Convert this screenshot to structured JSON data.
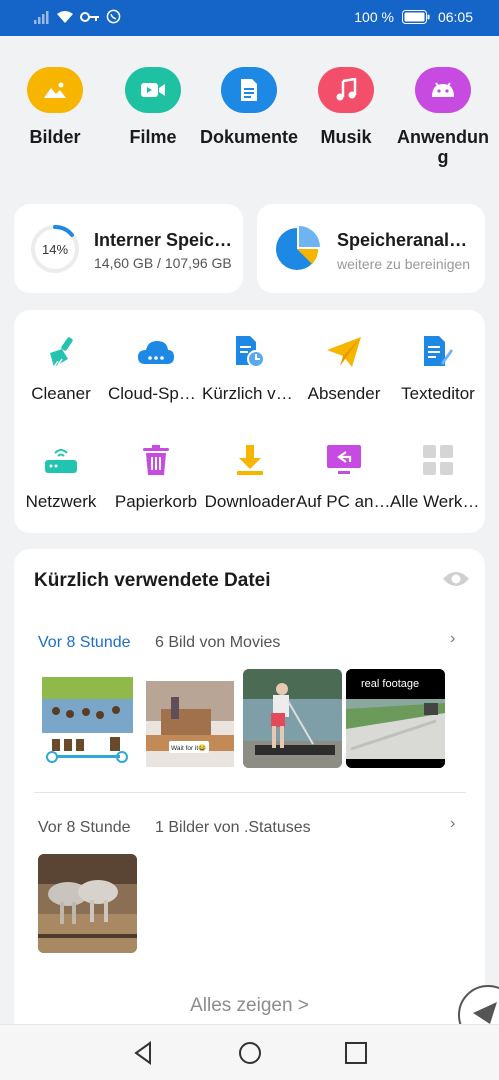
{
  "status_bar": {
    "battery": "100 %",
    "time": "06:05"
  },
  "categories": [
    {
      "label": "Bilder",
      "icon": "image-icon",
      "color": "#f7b500"
    },
    {
      "label": "Filme",
      "icon": "video-icon",
      "color": "#1fc1a3"
    },
    {
      "label": "Dokumente",
      "icon": "document-icon",
      "color": "#1e88e5"
    },
    {
      "label": "Musik",
      "icon": "music-icon",
      "color": "#f34f6a"
    },
    {
      "label": "Anwendung",
      "icon": "android-icon",
      "color": "#c74be0"
    }
  ],
  "storage": {
    "internal": {
      "percent": "14%",
      "percent_value": 14,
      "title": "Interner Speicher",
      "sub": "14,60 GB / 107,96 GB"
    },
    "analysis": {
      "title": "Speicheranalyse",
      "sub": "weitere zu bereinigen"
    }
  },
  "tools": [
    {
      "label": "Cleaner",
      "icon": "broom-icon"
    },
    {
      "label": "Cloud-Speicher",
      "icon": "cloud-icon"
    },
    {
      "label": "Kürzlich verwendet",
      "icon": "recent-file-icon"
    },
    {
      "label": "Absender",
      "icon": "paper-plane-icon"
    },
    {
      "label": "Texteditor",
      "icon": "text-editor-icon"
    },
    {
      "label": "Netzwerk",
      "icon": "router-icon"
    },
    {
      "label": "Papierkorb",
      "icon": "trash-icon"
    },
    {
      "label": "Downloader",
      "icon": "download-icon"
    },
    {
      "label": "Auf PC anzeigen",
      "icon": "pc-icon"
    },
    {
      "label": "Alle Werkzeuge",
      "icon": "grid-icon"
    }
  ],
  "recent": {
    "title": "Kürzlich verwendete Datei",
    "groups": [
      {
        "time": "Vor 8 Stunde",
        "desc": "6 Bild von Movies",
        "thumbs": [
          {
            "caption": ""
          },
          {
            "caption": "Wait for it😂"
          },
          {
            "caption": ""
          },
          {
            "caption": "real footage"
          }
        ]
      },
      {
        "time": "Vor 8 Stunde",
        "desc": "1 Bilder von .Statuses",
        "thumbs": [
          {
            "caption": ""
          }
        ]
      }
    ],
    "show_all": "Alles zeigen >"
  },
  "navbar": {
    "back": "back-icon",
    "home": "home-icon",
    "recents": "recents-icon"
  }
}
